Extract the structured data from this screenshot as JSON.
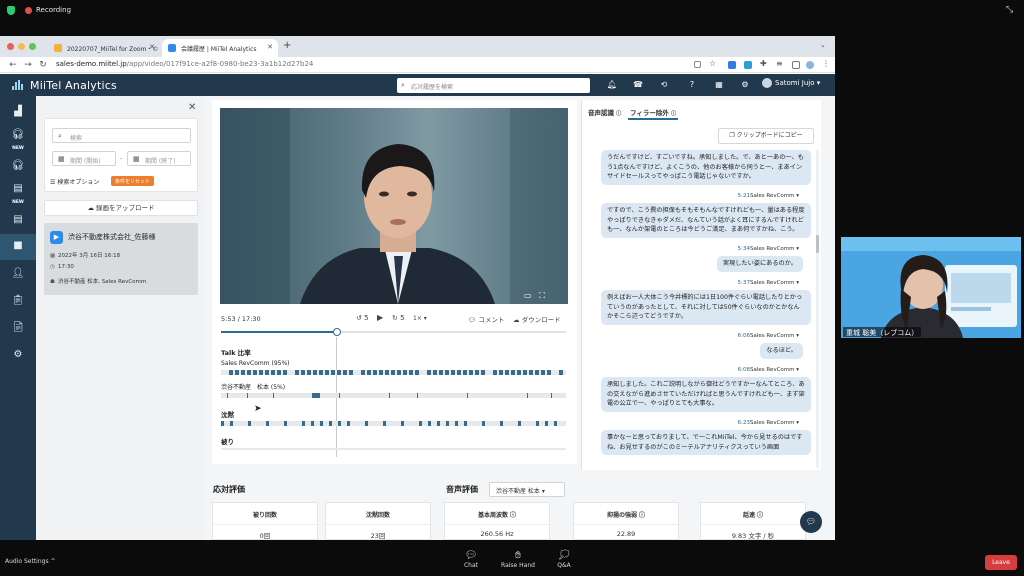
{
  "zoom": {
    "recording_label": "Recording",
    "audio_settings": "Audio Settings",
    "audio_caret": "^",
    "buttons": [
      {
        "label": "Chat",
        "icon": "chat-icon"
      },
      {
        "label": "Raise Hand",
        "icon": "hand-icon"
      },
      {
        "label": "Q&A",
        "icon": "qa-icon"
      }
    ],
    "leave_label": "Leave",
    "participant_name": "重城 聡美（レブコム）"
  },
  "browser": {
    "tabs": [
      {
        "title": "20220707_MiiTel for Zoom・©",
        "active": false
      },
      {
        "title": "会議履歴 | MiiTel Analytics",
        "active": true
      }
    ],
    "new_tab": "+",
    "url_host": "sales-demo.miitel.jp",
    "url_path": "/app/video/017f91ce-a2f8-0980-be23-3a1b12d27b24"
  },
  "app": {
    "logo_text": "MiiTel Analytics",
    "search_placeholder": "応対履歴を検索",
    "user_name": "Satomi Jujo",
    "rail_new_label": "NEW"
  },
  "sidebar": {
    "search_placeholder": "検索",
    "date_start_placeholder": "期間 (開始)",
    "date_sep": "-",
    "date_end_placeholder": "期間 (終了)",
    "filter_options_label": "検索オプション",
    "reset_label": "条件をリセット",
    "upload_label": "録画をアップロード",
    "recording": {
      "title": "渋谷不動産株式会社_佐藤様",
      "datetime": "2022年 3月 16日 16:18",
      "time": "17:30",
      "participants": "渋谷不動産 松本, Sales RevComm"
    }
  },
  "player": {
    "time_readout": "5:53 / 17:30",
    "back_label": "5",
    "fwd_label": "5",
    "speed_label": "1×",
    "comment_label": "コメント",
    "download_label": "ダウンロード",
    "progress_fraction": 0.337,
    "talk_ratio_title": "Talk 比率",
    "speaker1": "Sales RevComm (95%)",
    "speaker2": "渋谷不動産　松本 (5%)",
    "silence_title": "沈黙",
    "overlap_title": "被り"
  },
  "transcript": {
    "tab_voice": "音声認識",
    "tab_filler": "フィラー除外",
    "copy_label": "クリップボードにコピー",
    "messages": [
      {
        "time": "",
        "speaker": "",
        "side": "left",
        "text": "うだんですけど、すごいですね。承知しました。で、あと一あの一、もう1点なんですけど、よくこうの、他のお客様から伺うと一、まあインサイドセールスってやっぱこう電話じゃないですか。"
      },
      {
        "time": "5:21",
        "speaker": "Sales RevComm",
        "side": "left",
        "text": "ですので、こう費の担保もそもそもんなですけれども一、量はある程度やっぱりできなきゃダメだ、なんていう話がよく耳にするんですけれども一、なんか架電のところは今どうご満足、まあ何ですかね、こう。"
      },
      {
        "time": "5:34",
        "speaker": "Sales RevComm",
        "side": "right",
        "text": "実現したい姿にあるのか。"
      },
      {
        "time": "5:37",
        "speaker": "Sales RevComm",
        "side": "left",
        "text": "例えばお一人大体こう今井標的には1日100件ぐらい電話したりとかっていうのがあったとして、それに対しては50件ぐらいなのかとかなんかそこら辺ってどうですか。"
      },
      {
        "time": "6:06",
        "speaker": "Sales RevComm",
        "side": "right",
        "text": "なるほど。"
      },
      {
        "time": "6:08",
        "speaker": "Sales RevComm",
        "side": "left",
        "text": "承知しました。これご説明しながら御社どうですかーなんてところ、あの交えながら進めさせていただければと思うんですけれども一、まず架電の公立で一、やっぱりとても大事な。"
      },
      {
        "time": "6:23",
        "speaker": "Sales RevComm",
        "side": "left",
        "text": "事かなーと思っておりまして、で一これMiiTel、今から見せるのはですね、お見せするのがこのミーテルアナリティクスっていう画面"
      }
    ]
  },
  "evaluation": {
    "response_title": "応対評価",
    "voice_title": "音声評価",
    "speaker_select": "渋谷不動産 松本",
    "metrics": [
      {
        "label": "被り回数",
        "value": "0回"
      },
      {
        "label": "沈黙回数",
        "value": "23回"
      },
      {
        "label": "基本周波数",
        "value": "260.56 Hz"
      },
      {
        "label": "抑揚の強弱",
        "value": "22.89"
      },
      {
        "label": "話速",
        "value": "9.83 文字 / 秒"
      }
    ]
  },
  "colors": {
    "app_header": "#22384c",
    "accent": "#2d6c91",
    "bubble": "#dbe8f3",
    "reset_orange": "#ee7d2c",
    "leave_red": "#d63d3d",
    "zoom_bg": "#0b0b0b"
  }
}
